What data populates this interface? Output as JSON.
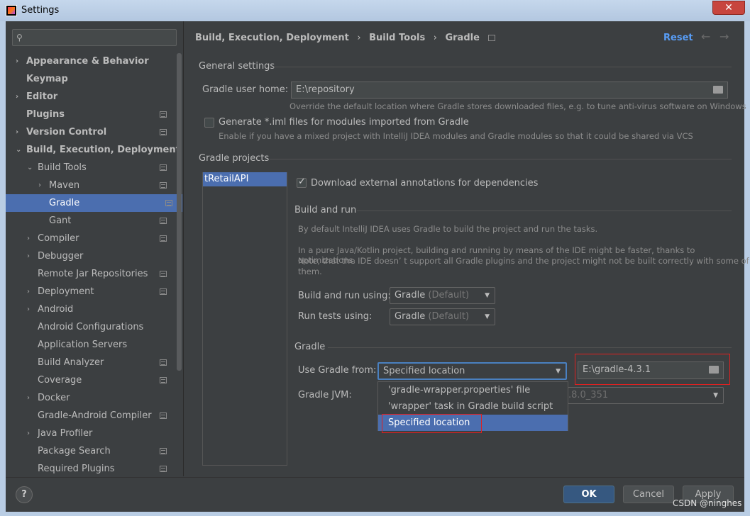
{
  "window": {
    "title": "Settings",
    "close": "✕"
  },
  "search": {
    "placeholder": "",
    "icon": "search-icon"
  },
  "sidebar": {
    "items": [
      {
        "label": "Appearance & Behavior",
        "chevron": "›"
      },
      {
        "label": "Keymap"
      },
      {
        "label": "Editor",
        "chevron": "›"
      },
      {
        "label": "Plugins"
      },
      {
        "label": "Version Control",
        "chevron": "›"
      },
      {
        "label": "Build, Execution, Deployment",
        "chevron": "⌄"
      },
      {
        "label": "Build Tools",
        "chevron": "⌄"
      },
      {
        "label": "Maven",
        "chevron": "›"
      },
      {
        "label": "Gradle"
      },
      {
        "label": "Gant"
      },
      {
        "label": "Compiler",
        "chevron": "›"
      },
      {
        "label": "Debugger",
        "chevron": "›"
      },
      {
        "label": "Remote Jar Repositories"
      },
      {
        "label": "Deployment",
        "chevron": "›"
      },
      {
        "label": "Android",
        "chevron": "›"
      },
      {
        "label": "Android Configurations"
      },
      {
        "label": "Application Servers"
      },
      {
        "label": "Build Analyzer"
      },
      {
        "label": "Coverage"
      },
      {
        "label": "Docker",
        "chevron": "›"
      },
      {
        "label": "Gradle-Android Compiler"
      },
      {
        "label": "Java Profiler",
        "chevron": "›"
      },
      {
        "label": "Package Search"
      },
      {
        "label": "Required Plugins"
      }
    ]
  },
  "header": {
    "crumb1": "Build, Execution, Deployment",
    "crumb2": "Build Tools",
    "crumb3": "Gradle",
    "sep": "›",
    "reset": "Reset",
    "back": "←",
    "forward": "→"
  },
  "general": {
    "title": "General settings",
    "home_label": "Gradle user home:",
    "home_value": "E:\\repository",
    "home_hint": "Override the default location where Gradle stores downloaded files, e.g. to tune anti-virus software on Windows",
    "iml_label": "Generate *.iml files for modules imported from Gradle",
    "iml_hint": "Enable if you have a mixed project with IntelliJ IDEA modules and Gradle modules so that it could be shared via VCS"
  },
  "projects": {
    "title": "Gradle projects",
    "selected": "tRetailAPI",
    "download_label": "Download external annotations for dependencies"
  },
  "build_run": {
    "title": "Build and run",
    "desc1": "By default IntelliJ IDEA uses Gradle to build the project and run the tasks.",
    "desc2a": "In a pure Java/Kotlin project, building and running by means of the IDE might be faster, thanks to optimizations.",
    "desc2b": "Note, that the IDE doesn’   t support all Gradle plugins and the project might not be built correctly with some of",
    "desc2c": "them.",
    "using_label": "Build and run using:",
    "using_value": "Gradle",
    "using_suffix": "(Default)",
    "tests_label": "Run tests using:",
    "tests_value": "Gradle",
    "tests_suffix": "(Default)"
  },
  "gradle": {
    "title": "Gradle",
    "from_label": "Use Gradle from:",
    "from_value": "Specified location",
    "location_value": "E:\\gradle-4.3.1",
    "jvm_label": "Gradle JVM:",
    "jvm_value": ".8.0_351",
    "options": [
      "'gradle-wrapper.properties' file",
      "'wrapper' task in Gradle build script",
      "Specified location"
    ]
  },
  "footer": {
    "help": "?",
    "ok": "OK",
    "cancel": "Cancel",
    "apply": "Apply",
    "watermark": "CSDN @ninghes"
  },
  "colors": {
    "accent": "#4b6eaf",
    "link": "#589df6",
    "highlight_box": "#e02020"
  }
}
